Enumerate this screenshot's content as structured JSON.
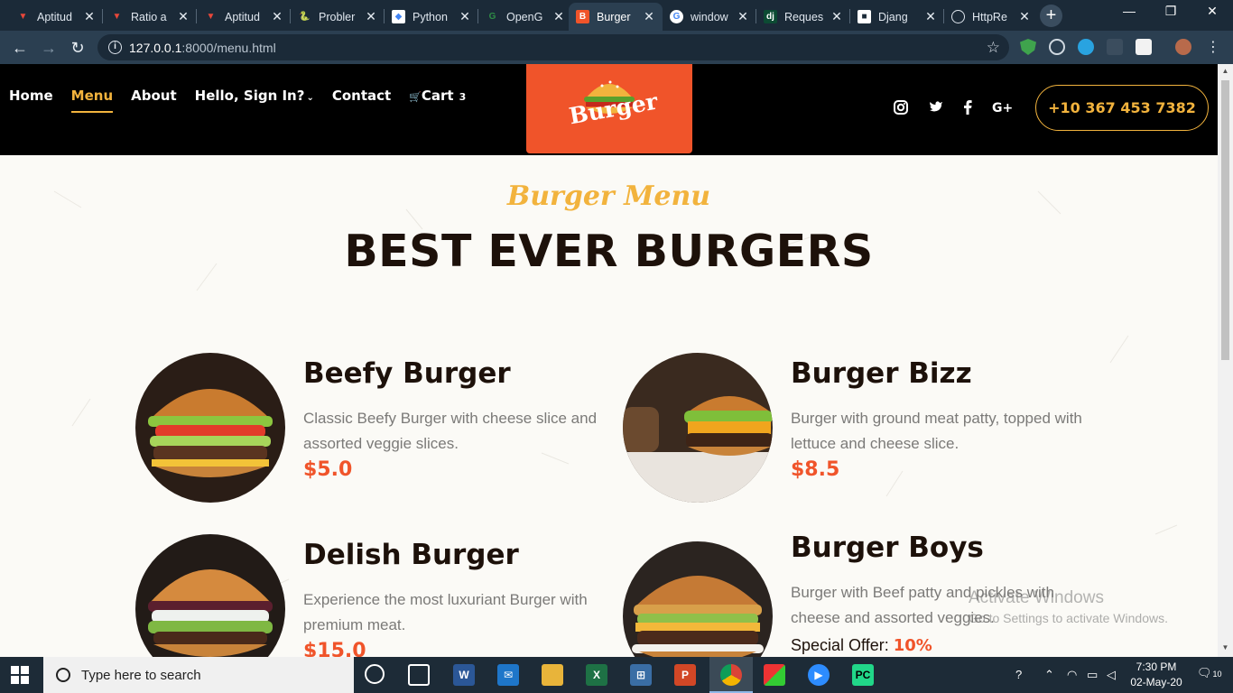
{
  "browser": {
    "tabs": [
      {
        "title": "Aptitud",
        "icon": "v-icon",
        "active": false
      },
      {
        "title": "Ratio a",
        "icon": "v-icon",
        "active": false
      },
      {
        "title": "Aptitud",
        "icon": "v-icon",
        "active": false
      },
      {
        "title": "Probler",
        "icon": "python-icon",
        "active": false
      },
      {
        "title": "Python",
        "icon": "diamond-icon",
        "active": false
      },
      {
        "title": "OpenG",
        "icon": "gfg-icon",
        "active": false
      },
      {
        "title": "Burger",
        "icon": "burger-fav-icon",
        "active": true
      },
      {
        "title": "window",
        "icon": "google-icon",
        "active": false
      },
      {
        "title": "Reques",
        "icon": "django-icon",
        "active": false
      },
      {
        "title": "Djang",
        "icon": "page-icon",
        "active": false
      },
      {
        "title": "HttpRe",
        "icon": "globe-icon",
        "active": false
      }
    ],
    "new_tab_label": "+",
    "url": {
      "host": "127.0.0.1",
      "path": ":8000/menu.html"
    },
    "window_controls": {
      "minimize": "—",
      "restore": "❐",
      "close": "✕"
    }
  },
  "site": {
    "nav": {
      "home": "Home",
      "menu": "Menu",
      "about": "About",
      "account": "Hello, Sign In?",
      "contact": "Contact",
      "cart": "Cart",
      "cart_count": "3"
    },
    "logo_text": "Burger",
    "social": {
      "instagram": "◎",
      "twitter": "🐦",
      "facebook": "f",
      "google": "G+"
    },
    "phone": "+10 367 453 7382",
    "accent": "#f2b33d",
    "brand": "#f0542a"
  },
  "menu_page": {
    "script_title": "Burger Menu",
    "title": "BEST EVER BURGERS",
    "items": [
      {
        "name": "Beefy Burger",
        "description": "Classic Beefy Burger with cheese slice and assorted veggie slices.",
        "price": "$5.0"
      },
      {
        "name": "Burger Bizz",
        "description": "Burger with ground meat patty, topped with lettuce and cheese slice.",
        "price": "$8.5"
      },
      {
        "name": "Delish Burger",
        "description": "Experience the most luxuriant Burger with premium meat.",
        "price": "$15.0"
      },
      {
        "name": "Burger Boys",
        "description": "Burger with Beef patty and pickles with cheese and assorted veggies.",
        "offer_label": "Special Offer:",
        "offer_value": "10%"
      }
    ]
  },
  "watermark": {
    "line1": "Activate Windows",
    "line2": "Go to Settings to activate Windows."
  },
  "taskbar": {
    "search_placeholder": "Type here to search",
    "time": "7:30 PM",
    "date": "02-May-20",
    "notification_count": "10"
  }
}
